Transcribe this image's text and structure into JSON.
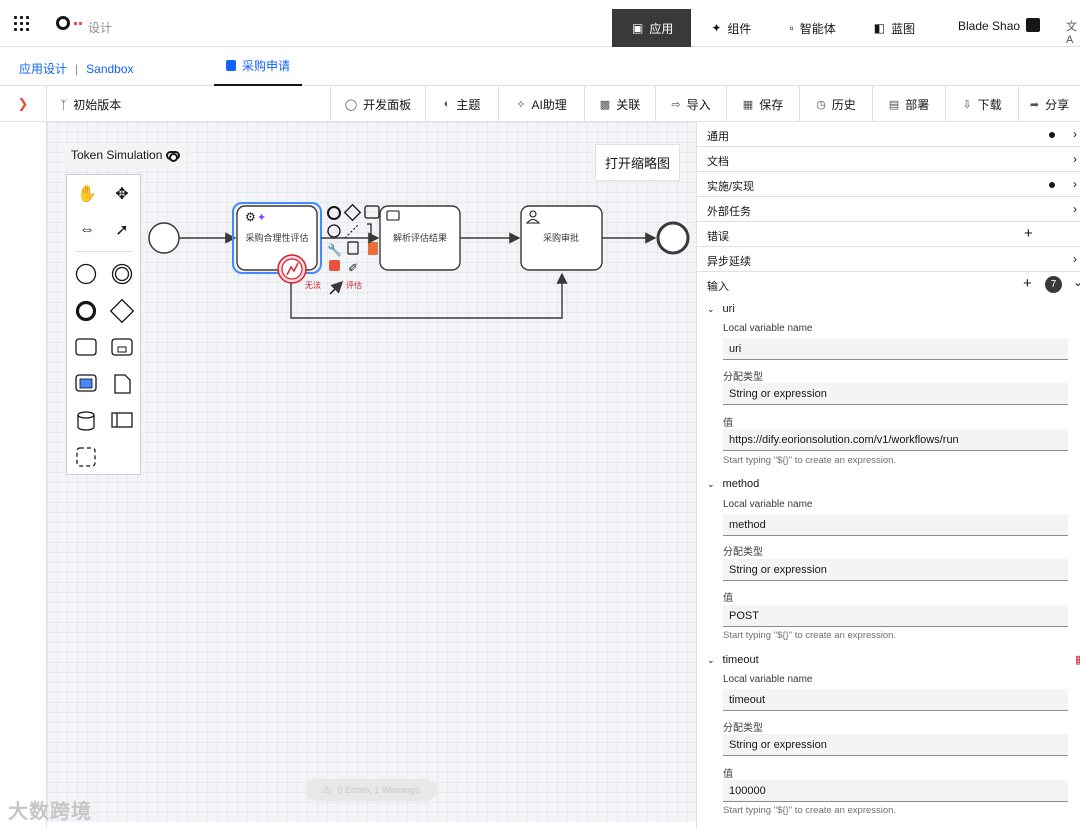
{
  "header": {
    "brand_text": "设计",
    "nav": [
      {
        "label": "应用",
        "icon": "app-icon",
        "active": true
      },
      {
        "label": "组件",
        "icon": "component-icon",
        "active": false
      },
      {
        "label": "智能体",
        "icon": "agent-icon",
        "active": false
      },
      {
        "label": "蓝图",
        "icon": "blueprint-icon",
        "active": false
      }
    ],
    "user_name": "Blade Shao",
    "lang_icon": "文A"
  },
  "breadcrumb": {
    "app": "应用设计",
    "separator": "|",
    "sandbox": "Sandbox",
    "tab": "采购申请"
  },
  "toolbar": {
    "version": "初始版本",
    "tools": [
      {
        "label": "开发面板",
        "icon": "toggle-icon"
      },
      {
        "label": "主题",
        "icon": "theme-icon"
      },
      {
        "label": "AI助理",
        "icon": "ai-icon"
      },
      {
        "label": "关联",
        "icon": "link-icon"
      },
      {
        "label": "导入",
        "icon": "import-icon"
      },
      {
        "label": "保存",
        "icon": "save-icon"
      },
      {
        "label": "历史",
        "icon": "history-icon"
      },
      {
        "label": "部署",
        "icon": "deploy-icon"
      },
      {
        "label": "下载",
        "icon": "download-icon"
      },
      {
        "label": "分享",
        "icon": "share-icon"
      }
    ]
  },
  "canvas": {
    "token_simulation": "Token Simulation",
    "minimap_button": "打开缩略图",
    "status": "0 Errors, 1 Warnings",
    "nodes": {
      "task1": "采购合理性评估",
      "task2": "解析评估结果",
      "task3": "采购审批"
    },
    "boundary_label": "无法评估",
    "label_fragment_left": "无法",
    "label_fragment_right": "评估"
  },
  "panel": {
    "sections": [
      {
        "label": "通用",
        "dot": true,
        "chevron": "›"
      },
      {
        "label": "文档",
        "dot": false,
        "chevron": "›"
      },
      {
        "label": "实施/实现",
        "dot": true,
        "chevron": "›"
      },
      {
        "label": "外部任务",
        "dot": false,
        "chevron": "›"
      },
      {
        "label": "错误",
        "plus": true
      },
      {
        "label": "异步延续",
        "dot": false,
        "chevron": "›"
      },
      {
        "label": "输入",
        "plus": true,
        "count": "7",
        "chevron": "⌄"
      }
    ],
    "inputs": [
      {
        "name": "uri",
        "local_label": "Local variable name",
        "local_value": "uri",
        "type_label": "分配类型",
        "type_value": "String or expression",
        "value_label": "值",
        "value": "https://dify.eorionsolution.com/v1/workflows/run",
        "hint": "Start typing \"${}\" to create an expression."
      },
      {
        "name": "method",
        "local_label": "Local variable name",
        "local_value": "method",
        "type_label": "分配类型",
        "type_value": "String or expression",
        "value_label": "值",
        "value": "POST",
        "hint": "Start typing \"${}\" to create an expression."
      },
      {
        "name": "timeout",
        "local_label": "Local variable name",
        "local_value": "timeout",
        "type_label": "分配类型",
        "type_value": "String or expression",
        "value_label": "值",
        "value": "100000",
        "hint": "Start typing \"${}\" to create an expression."
      }
    ]
  },
  "watermark": "大数跨境",
  "colors": {
    "accent": "#0f62fe",
    "active_nav": "#393939",
    "selection": "#4589ff",
    "error": "#da1e28",
    "ai": "#8a3ffc"
  }
}
